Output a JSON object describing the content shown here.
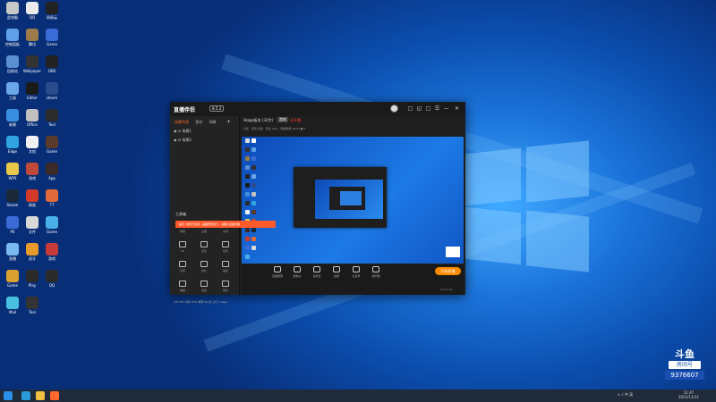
{
  "desktop": {
    "icons": [
      {
        "label": "此电脑",
        "color": "#c8c8c8"
      },
      {
        "label": "QQ",
        "color": "#eaeaea"
      },
      {
        "label": "网易云",
        "color": "#222"
      },
      {
        "label": "控制面板",
        "color": "#5fa0e8"
      },
      {
        "label": "腾讯",
        "color": "#9c7a4a"
      },
      {
        "label": "Game",
        "color": "#3a6bd6"
      },
      {
        "label": "回收站",
        "color": "#5a8fd0"
      },
      {
        "label": "Wallpaper",
        "color": "#333"
      },
      {
        "label": "OBS",
        "color": "#222"
      },
      {
        "label": "工具",
        "color": "#6ba6e8"
      },
      {
        "label": "Editor",
        "color": "#1a1a1a"
      },
      {
        "label": "steam",
        "color": "#2a4b8c"
      },
      {
        "label": "新建",
        "color": "#3b8fe0"
      },
      {
        "label": "Office",
        "color": "#c0c0c0"
      },
      {
        "label": "Tool",
        "color": "#2b2b2b"
      },
      {
        "label": "Edge",
        "color": "#2fa4e0"
      },
      {
        "label": "文档",
        "color": "#f0f0f0"
      },
      {
        "label": "Game",
        "color": "#5a3a2a"
      },
      {
        "label": "WPS",
        "color": "#e8c84a"
      },
      {
        "label": "游戏",
        "color": "#c04a3a"
      },
      {
        "label": "App",
        "color": "#3a2a2a"
      },
      {
        "label": "Steam",
        "color": "#1b2838"
      },
      {
        "label": "网易",
        "color": "#d43a2a"
      },
      {
        "label": "TT",
        "color": "#e06a3a"
      },
      {
        "label": "PS",
        "color": "#3a6ad6"
      },
      {
        "label": "文件",
        "color": "#d8d8d8"
      },
      {
        "label": "Game",
        "color": "#4ab0e8"
      },
      {
        "label": "直播",
        "color": "#7ab8f0"
      },
      {
        "label": "虎牙",
        "color": "#e89a2a"
      },
      {
        "label": "游戏",
        "color": "#c83a3a"
      },
      {
        "label": "Game",
        "color": "#d8a030"
      },
      {
        "label": "Play",
        "color": "#2a2a2a"
      },
      {
        "label": "QQ",
        "color": "#2a2a2a"
      },
      {
        "label": "Mail",
        "color": "#4ac0e0"
      },
      {
        "label": "Tool",
        "color": "#333"
      }
    ]
  },
  "app": {
    "logo": "直播伴侣",
    "version": "8.5.3",
    "titlebar_buttons": [
      "□",
      "◱",
      "□",
      "☰",
      "—",
      "✕"
    ],
    "sidebar": {
      "tabs": [
        {
          "label": "场景列表",
          "active": true
        },
        {
          "label": "素材"
        },
        {
          "label": "弹幕"
        }
      ],
      "add": "+",
      "scenes": [
        "场景1",
        "场景2"
      ],
      "tools_title": "工具箱",
      "tools": [
        {
          "label": "视频"
        },
        {
          "label": "主播"
        },
        {
          "label": "房间"
        },
        {
          "label": "PK"
        },
        {
          "label": "连麦"
        },
        {
          "label": "任务"
        },
        {
          "label": "高能"
        },
        {
          "label": "送礼"
        },
        {
          "label": "抽奖"
        },
        {
          "label": "福袋"
        },
        {
          "label": "活动"
        },
        {
          "label": "更多"
        }
      ],
      "footer": "CPU 8%  内存 35%  帧率 60 帧  上行 1 kbps"
    },
    "stream": {
      "title": "Stage板块 (33字)",
      "category": "游戏",
      "status": "未开播",
      "subtitle": "分区 · 游戏  标签 · 测试  Type · 网络质量  33/33  ● 0"
    },
    "controls": [
      {
        "label": "直播屏幕"
      },
      {
        "label": "摄像头"
      },
      {
        "label": "多机位"
      },
      {
        "label": "投屏"
      },
      {
        "label": "麦克风"
      },
      {
        "label": "扬声器"
      }
    ],
    "go_live": "开始直播",
    "live_time": "00:00:00",
    "banner": "提示: 场景已切换，画面预览如下，请确认直播内容"
  },
  "taskbar": {
    "start_icon": "windows-icon",
    "tray_text": "∧  ♪  中  英",
    "time": "11:47",
    "date": "2021/11/11"
  },
  "watermark": {
    "brand": "斗鱼",
    "label": "房间号",
    "room": "9376607"
  }
}
